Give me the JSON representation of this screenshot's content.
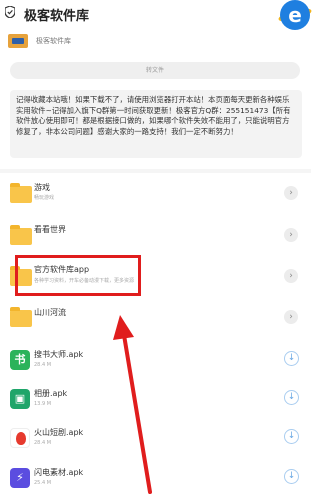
{
  "header": {
    "title": "极客软件库",
    "icon": "shield-check-icon",
    "browser_icon": "ie-icon",
    "browser_glyph": "e"
  },
  "subheader": {
    "text": "极客软件库",
    "logo": "brand-logo"
  },
  "share_button": {
    "label": "转文件"
  },
  "notice": {
    "text": "记得收藏本站哦！如果下载不了，请使用浏览器打开本站！本页面每天更新各种娱乐实用软件~记得加入旗下Q群第一时间获取更新！极客官方Q群：255151473【所有软件放心使用即可！都是根据接口做的，如果哪个软件失效不能用了，只能说明官方修复了，非本公司问题】感谢大家的一路支持！我们一定不断努力！"
  },
  "folders": [
    {
      "title": "游戏",
      "subtitle": "畅玩游戏",
      "icon": "folder-icon"
    },
    {
      "title": "看看世界",
      "subtitle": "",
      "icon": "folder-icon"
    },
    {
      "title": "官方软件库app",
      "subtitle": "各种学习资料，开车必备动漫下载，更多资源",
      "icon": "folder-icon"
    },
    {
      "title": "山川河流",
      "subtitle": "",
      "icon": "folder-icon"
    }
  ],
  "files": [
    {
      "name": "搜书大师.apk",
      "size": "28.4 M",
      "icon": "book-app-icon",
      "glyph": "书"
    },
    {
      "name": "相册.apk",
      "size": "13.9 M",
      "icon": "photo-app-icon",
      "glyph": "▣"
    },
    {
      "name": "火山短剧.apk",
      "size": "28.4 M",
      "icon": "fire-app-icon",
      "glyph": ""
    },
    {
      "name": "闪电素材.apk",
      "size": "25.4 M",
      "icon": "flash-app-icon",
      "glyph": "⚡"
    }
  ],
  "glyphs": {
    "chevron": "›",
    "download": "↓"
  },
  "colors": {
    "highlight": "#e01d1d",
    "folder": "#f9c54a",
    "download": "#6aa8e4",
    "browser": "#1f7fe0"
  }
}
